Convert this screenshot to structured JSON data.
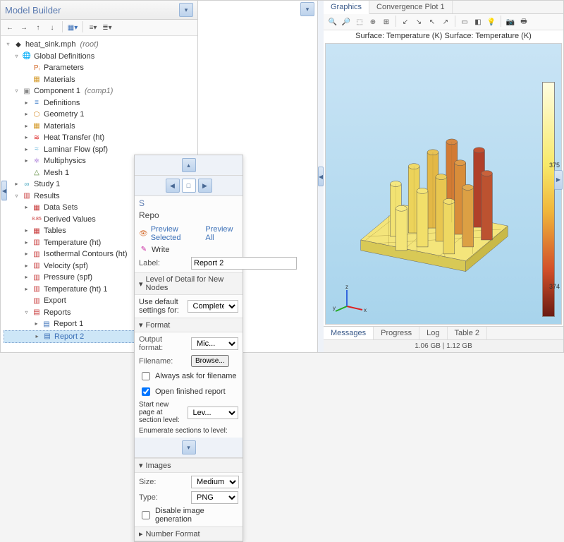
{
  "panel_title": "Model Builder",
  "tree": {
    "root": {
      "label": "heat_sink.mph",
      "suffix": "(root)"
    },
    "global_defs": "Global Definitions",
    "parameters": "Parameters",
    "materials": "Materials",
    "component": {
      "label": "Component 1",
      "suffix": "(comp1)"
    },
    "definitions": "Definitions",
    "geometry": "Geometry 1",
    "materials2": "Materials",
    "heat_transfer": "Heat Transfer (ht)",
    "laminar": "Laminar Flow (spf)",
    "multiphysics": "Multiphysics",
    "mesh": "Mesh 1",
    "study": "Study 1",
    "results": "Results",
    "data_sets": "Data Sets",
    "derived": "Derived Values",
    "tables": "Tables",
    "temp_ht": "Temperature (ht)",
    "iso": "Isothermal Contours (ht)",
    "velocity": "Velocity (spf)",
    "pressure": "Pressure (spf)",
    "temp_ht1": "Temperature (ht) 1",
    "export": "Export",
    "reports": "Reports",
    "report1": "Report 1",
    "report2": "Report 2"
  },
  "graphics_tabs": {
    "graphics": "Graphics",
    "convergence": "Convergence Plot 1"
  },
  "plot_title": "Surface: Temperature (K)  Surface: Temperature (K)",
  "colorbar": {
    "top": "375",
    "bottom": "374"
  },
  "axes": {
    "x": "x",
    "y": "y",
    "z": "z"
  },
  "bottom_tabs": {
    "messages": "Messages",
    "progress": "Progress",
    "log": "Log",
    "table2": "Table 2"
  },
  "status": "1.06 GB | 1.12 GB",
  "settings": {
    "s_label": "S",
    "repo_hdr": "Repo",
    "preview_selected": "Preview Selected",
    "preview_all": "Preview All",
    "write": "Write",
    "label_label": "Label:",
    "label_value": "Report 2",
    "level_hdr": "Level of Detail for New Nodes",
    "use_default": "Use default settings for:",
    "use_default_value": "Complete",
    "format_hdr": "Format",
    "output_format": "Output format:",
    "output_format_value": "Mic...",
    "filename": "Filename:",
    "browse": "Browse...",
    "always_ask": "Always ask for filename",
    "open_finished": "Open finished report",
    "start_new_page": "Start new page at section level:",
    "start_new_page_value": "Lev...",
    "enumerate": "Enumerate sections to level:",
    "images_hdr": "Images",
    "size_label": "Size:",
    "size_value": "Medium",
    "type_label": "Type:",
    "type_value": "PNG",
    "disable_img": "Disable image generation",
    "number_hdr": "Number Format"
  }
}
